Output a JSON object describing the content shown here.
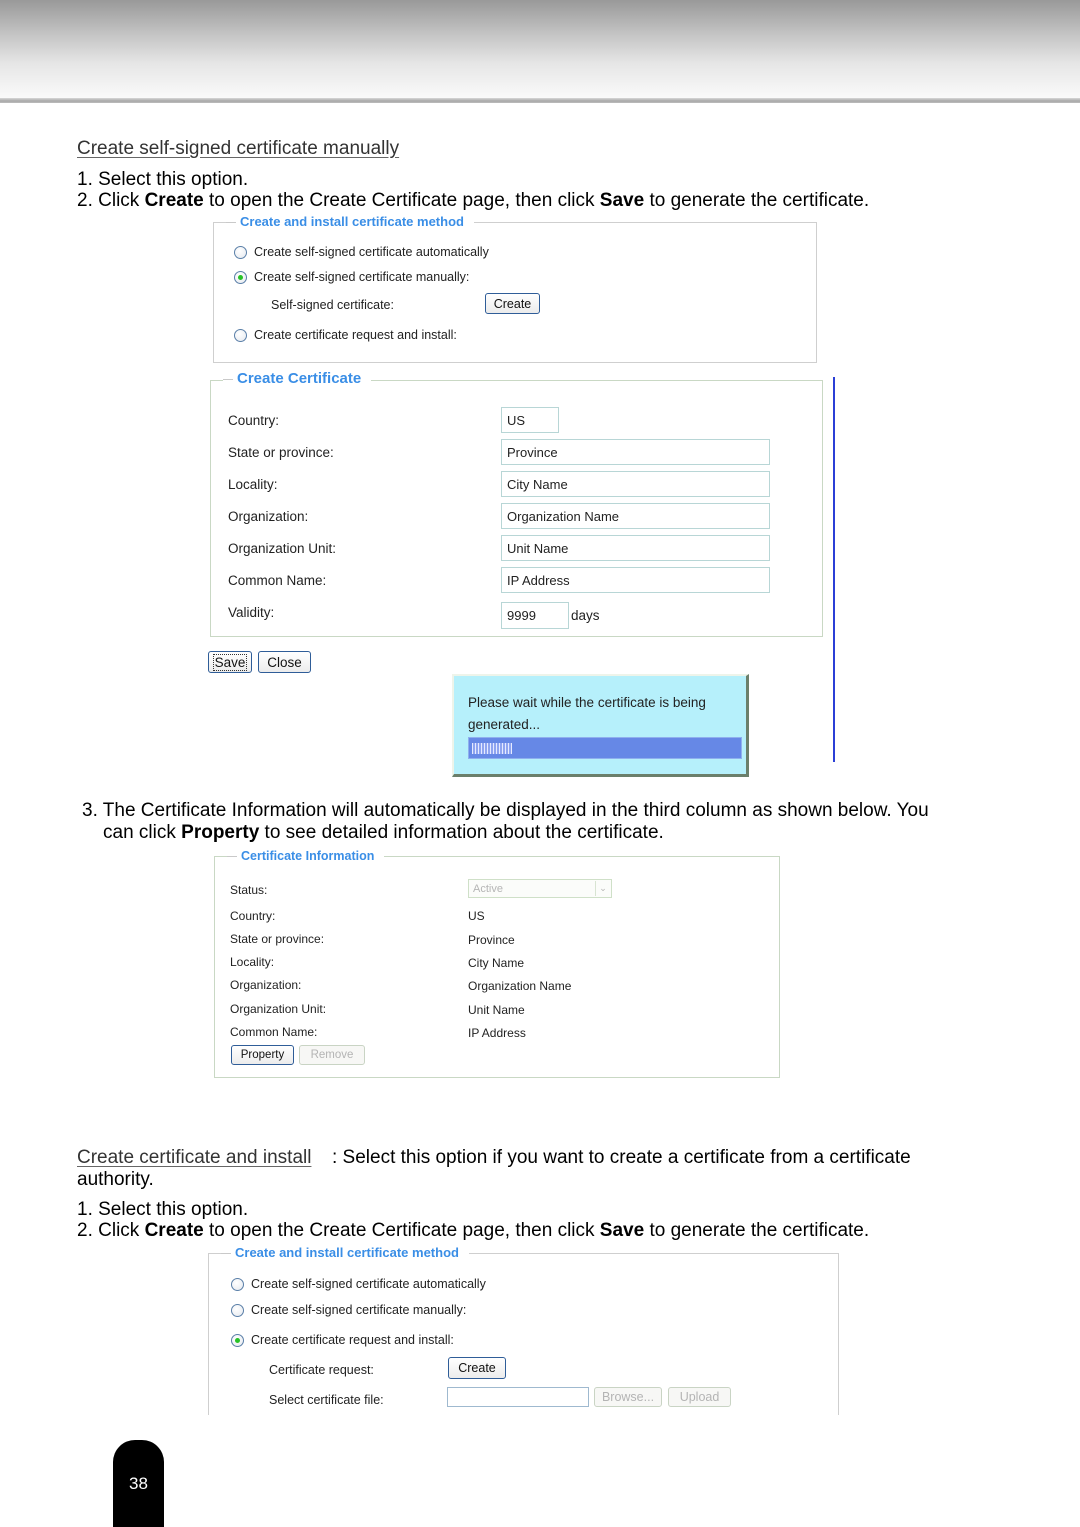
{
  "page": {
    "number": "38"
  },
  "section1": {
    "heading": "Create self-signed certificate manually",
    "step1": "1. Select this option.",
    "step2": {
      "prefix": "2. Click ",
      "b1": "Create",
      "mid": " to open the Create Certificate page, then click ",
      "b2": "Save",
      "suffix": " to generate the certificate."
    }
  },
  "method_panel_1": {
    "legend": "Create and install certificate method",
    "options": [
      {
        "label": "Create self-signed certificate automatically",
        "checked": false
      },
      {
        "label": "Create self-signed certificate manually:",
        "checked": true
      },
      {
        "label": "Create certificate request and install:",
        "checked": false
      }
    ],
    "self_signed_label": "Self-signed certificate:",
    "create_button": "Create"
  },
  "create_certificate": {
    "legend": "Create Certificate",
    "fields": [
      {
        "label": "Country:",
        "value": "US"
      },
      {
        "label": "State or province:",
        "value": "Province"
      },
      {
        "label": "Locality:",
        "value": "City Name"
      },
      {
        "label": "Organization:",
        "value": "Organization Name"
      },
      {
        "label": "Organization Unit:",
        "value": "Unit Name"
      },
      {
        "label": "Common Name:",
        "value": "IP Address"
      },
      {
        "label": "Validity:",
        "value": "9999",
        "unit": "days"
      }
    ],
    "save_button": "Save",
    "close_button": "Close"
  },
  "wait_dialog": {
    "message": "Please wait while the certificate is being generated...",
    "progress_percent": 15,
    "colors": {
      "background": "#b6f0fb",
      "bar": "#6688e6"
    }
  },
  "step3": {
    "line1": "3. The Certificate Information will automatically be displayed in the third column as shown below. You",
    "line2": {
      "prefix": "can click ",
      "b": "Property",
      "suffix": " to see detailed information about the certificate."
    }
  },
  "certificate_information": {
    "legend": "Certificate Information",
    "status_label": "Status:",
    "status_value": "Active",
    "rows": [
      {
        "label": "Country:",
        "value": "US"
      },
      {
        "label": "State or province:",
        "value": "Province"
      },
      {
        "label": "Locality:",
        "value": "City Name"
      },
      {
        "label": "Organization:",
        "value": "Organization Name"
      },
      {
        "label": "Organization Unit:",
        "value": "Unit Name"
      },
      {
        "label": "Common Name:",
        "value": "IP Address"
      }
    ],
    "property_button": "Property",
    "remove_button": "Remove"
  },
  "section2": {
    "heading": "Create certificate and install",
    "desc_line1": " :  Select this option if you want to create a certificate from a certificate",
    "desc_line2": "authority.",
    "step1": "1. Select this option.",
    "step2": {
      "prefix": "2. Click ",
      "b1": "Create",
      "mid": " to open the Create Certificate page, then click ",
      "b2": "Save",
      "suffix": " to generate the certificate."
    }
  },
  "method_panel_2": {
    "legend": "Create and install certificate method",
    "options": [
      {
        "label": "Create self-signed certificate automatically",
        "checked": false
      },
      {
        "label": "Create self-signed certificate manually:",
        "checked": false
      },
      {
        "label": "Create certificate request and install:",
        "checked": true
      }
    ],
    "cert_request_label": "Certificate request:",
    "create_button": "Create",
    "select_file_label": "Select certificate file:",
    "file_value": "",
    "browse_button": "Browse...",
    "upload_button": "Upload"
  },
  "accent_colors": {
    "legend_blue": "#3a8ee6",
    "radio_green": "#27c227"
  }
}
